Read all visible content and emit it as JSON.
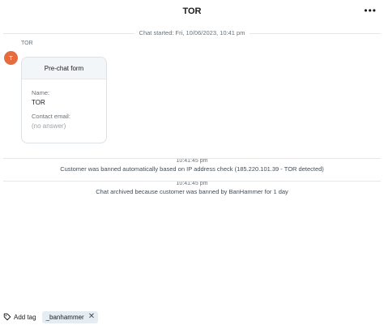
{
  "header": {
    "title": "TOR",
    "more_icon": "more-horizontal-icon",
    "more_glyph": "•••"
  },
  "chat_started": "Chat started: Fri, 10/06/2023, 10:41 pm",
  "message": {
    "author": "TOR",
    "avatar_initial": "T",
    "avatar_color": "#e66b3e",
    "form": {
      "title": "Pre-chat form",
      "fields": [
        {
          "label": "Name:",
          "value": "TOR"
        },
        {
          "label": "Contact email:",
          "value": "(no answer)"
        }
      ]
    }
  },
  "events": [
    {
      "time": "10:41:45 pm",
      "text": "Customer was banned automatically based on IP address check (185.220.101.39 - TOR detected)"
    },
    {
      "time": "10:41:45 pm",
      "text": "Chat archived because customer was banned by BanHammer for 1 day"
    }
  ],
  "tags": {
    "add_label": "Add tag",
    "add_icon": "tag-icon",
    "items": [
      {
        "label": "_banhammer",
        "remove_glyph": "✕"
      }
    ]
  }
}
